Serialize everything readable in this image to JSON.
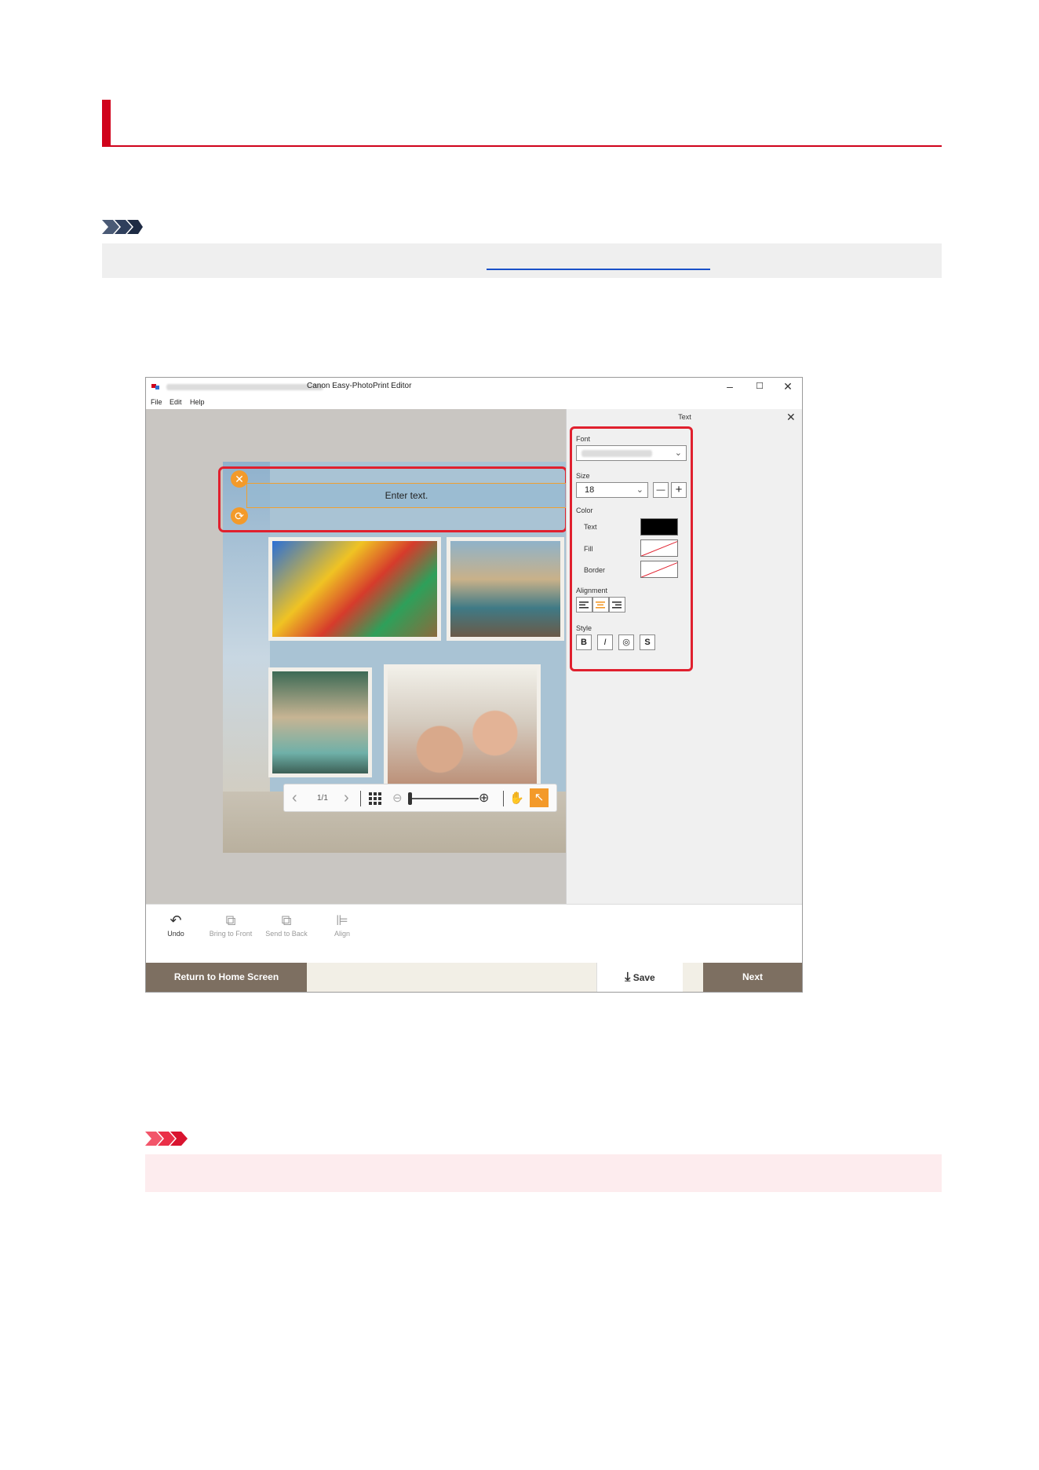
{
  "document": {
    "note_link_text": ""
  },
  "app": {
    "title": "Canon Easy-PhotoPrint Editor",
    "window_controls": {
      "minimize": "–",
      "maximize": "☐",
      "close": "✕"
    },
    "menu": [
      "File",
      "Edit",
      "Help"
    ],
    "canvas": {
      "text_box_placeholder": "Enter text.",
      "handle_delete": "✕",
      "handle_rotate": "⟳"
    },
    "zoom_bar": {
      "prev": "‹",
      "page_indicator": "1/1",
      "next": "›",
      "grid_icon": "grid-icon",
      "zoom_out": "⊖",
      "zoom_in": "⊕",
      "zoom_level": 0.0,
      "hand_tool": "✋",
      "select_tool": "↖"
    },
    "text_panel": {
      "title": "Text",
      "close": "✕",
      "font_label": "Font",
      "font_value": "",
      "size_label": "Size",
      "size_value": "18",
      "size_minus": "—",
      "size_plus": "+",
      "color_label": "Color",
      "color_text_label": "Text",
      "color_fill_label": "Fill",
      "color_border_label": "Border",
      "text_color": "#000000",
      "alignment_label": "Alignment",
      "alignment_selected": "center",
      "style_label": "Style",
      "style_buttons": [
        "B",
        "I",
        "◎",
        "S"
      ]
    },
    "bottom_tools": [
      {
        "label": "Undo",
        "icon": "↶",
        "enabled": true
      },
      {
        "label": "Bring to Front",
        "icon": "⧉",
        "enabled": false
      },
      {
        "label": "Send to Back",
        "icon": "⧉",
        "enabled": false
      },
      {
        "label": "Align",
        "icon": "⊫",
        "enabled": false
      }
    ],
    "footer": {
      "home": "Return to Home Screen",
      "save": "Save",
      "save_icon": "⤓",
      "next": "Next"
    },
    "accent_color": "#f39a2a",
    "highlight_color": "#e0202e"
  }
}
